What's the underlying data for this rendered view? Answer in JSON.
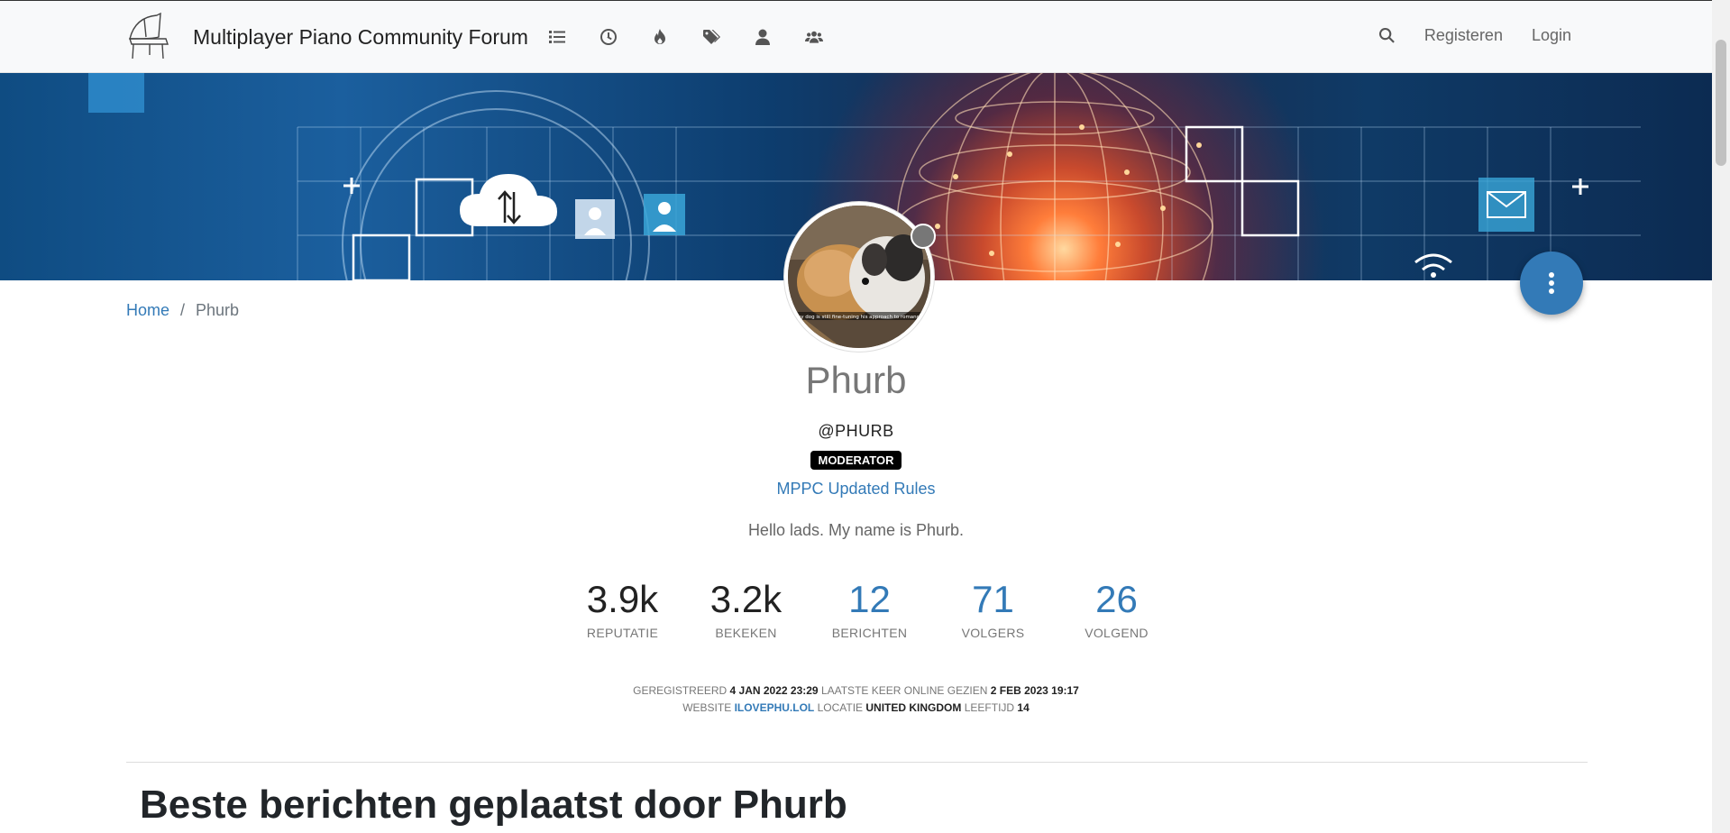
{
  "navbar": {
    "title": "Multiplayer Piano Community Forum",
    "icons": [
      "categories-icon",
      "recent-icon",
      "popular-icon",
      "tags-icon",
      "users-icon",
      "groups-icon"
    ],
    "register": "Registeren",
    "login": "Login"
  },
  "breadcrumb": {
    "home": "Home",
    "separator": "/",
    "current": "Phurb"
  },
  "profile": {
    "fullname": "Phurb",
    "username": "@PHURB",
    "badge": "MODERATOR",
    "link": "MPPC Updated Rules",
    "bio": "Hello lads. My name is Phurb.",
    "avatar_caption": "my dog is still fine-tuning his approach to romance",
    "status": "offline"
  },
  "stats": [
    {
      "value": "3.9k",
      "label": "REPUTATIE"
    },
    {
      "value": "3.2k",
      "label": "BEKEKEN"
    },
    {
      "value": "12",
      "label": "BERICHTEN"
    },
    {
      "value": "71",
      "label": "VOLGERS"
    },
    {
      "value": "26",
      "label": "VOLGEND"
    }
  ],
  "meta": {
    "registered_label": "GEREGISTREERD",
    "registered_value": "4 JAN 2022 23:29",
    "last_online_label": "LAATSTE KEER ONLINE GEZIEN",
    "last_online_value": "2 FEB 2023 19:17",
    "website_label": "WEBSITE",
    "website_value": "ILOVEPHU.LOL",
    "location_label": "LOCATIE",
    "location_value": "UNITED KINGDOM",
    "age_label": "LEEFTIJD",
    "age_value": "14"
  },
  "section_title": "Beste berichten geplaatst door Phurb",
  "colors": {
    "accent": "#337ab7",
    "navbar_bg": "#f8f9fa",
    "badge_bg": "#000000"
  }
}
